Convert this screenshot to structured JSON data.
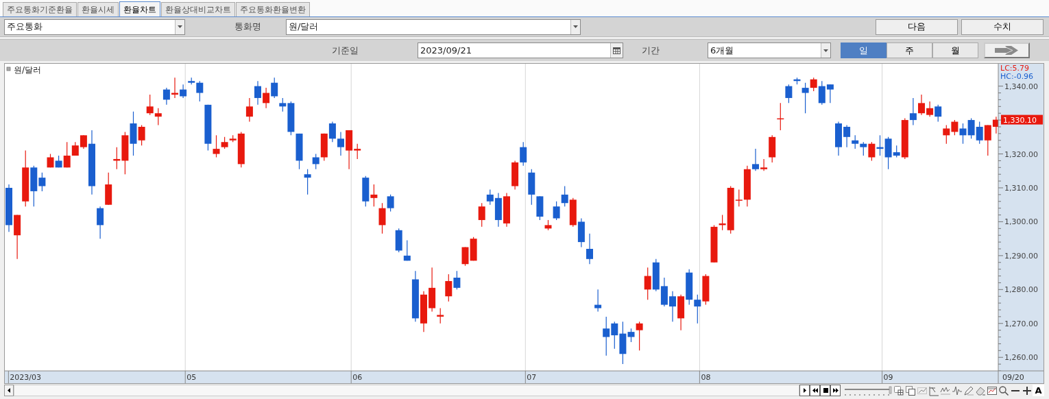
{
  "tabs": [
    {
      "label": "주요통화기준환율",
      "selected": false
    },
    {
      "label": "환율시세",
      "selected": false
    },
    {
      "label": "환율차트",
      "selected": true
    },
    {
      "label": "환율상대비교차트",
      "selected": false
    },
    {
      "label": "주요통화환율변환",
      "selected": false
    }
  ],
  "filter": {
    "group": "주요통화",
    "currency_label": "통화명",
    "currency": "원/달러",
    "buttons": [
      "다음",
      "수치"
    ]
  },
  "query": {
    "date_label": "기준일",
    "date": "2023/09/21",
    "period_label": "기간",
    "period": "6개월",
    "intervals": [
      {
        "label": "일",
        "selected": true
      },
      {
        "label": "주",
        "selected": false
      },
      {
        "label": "월",
        "selected": false
      }
    ]
  },
  "chart": {
    "lc_label": "LC:5.79",
    "hc_label": "HC:-0.96",
    "last_price_label": "1,330.10",
    "x_end_label": "09/20",
    "chart_data": {
      "type": "candlestick",
      "title": "원/달러",
      "ylim": [
        1256,
        1346.6
      ],
      "yticks": [
        {
          "value": 1260,
          "label": "1,260.00"
        },
        {
          "value": 1270,
          "label": "1,270.00"
        },
        {
          "value": 1280,
          "label": "1,280.00"
        },
        {
          "value": 1290,
          "label": "1,290.00"
        },
        {
          "value": 1300,
          "label": "1,300.00"
        },
        {
          "value": 1310,
          "label": "1,310.00"
        },
        {
          "value": 1320,
          "label": "1,320.00"
        },
        {
          "value": 1340,
          "label": "1,340.00"
        }
      ],
      "categories": [
        null,
        null,
        "2023/03",
        null,
        null,
        null,
        null,
        null,
        null,
        null,
        null,
        null,
        null,
        null,
        null,
        null,
        null,
        null,
        null,
        null,
        null,
        null,
        "05",
        null,
        null,
        null,
        null,
        null,
        null,
        null,
        null,
        null,
        null,
        null,
        null,
        null,
        null,
        null,
        null,
        null,
        null,
        null,
        "06",
        null,
        null,
        null,
        null,
        null,
        null,
        null,
        null,
        null,
        null,
        null,
        null,
        null,
        null,
        null,
        null,
        null,
        null,
        null,
        null,
        "07",
        null,
        null,
        null,
        null,
        null,
        null,
        null,
        null,
        null,
        null,
        null,
        null,
        null,
        null,
        null,
        null,
        null,
        null,
        null,
        null,
        "08",
        null,
        null,
        null,
        null,
        null,
        null,
        null,
        null,
        null,
        null,
        null,
        null,
        null,
        null,
        null,
        null,
        null,
        null,
        null,
        null,
        null,
        "09",
        null,
        null,
        null,
        null,
        null,
        null,
        null,
        null,
        null,
        null,
        null,
        null,
        null
      ],
      "ohlc": [
        [
          1310,
          1311,
          1297,
          1299
        ],
        [
          1296,
          1302,
          1289,
          1302
        ],
        [
          1306,
          1321,
          1304.5,
          1316
        ],
        [
          1316,
          1316.5,
          1304.5,
          1309
        ],
        [
          1313,
          1314.5,
          1309,
          1310.5
        ],
        [
          1316,
          1320,
          1316,
          1319
        ],
        [
          1318,
          1319.5,
          1316,
          1316
        ],
        [
          1316,
          1323.5,
          1316,
          1319.5
        ],
        [
          1319.5,
          1323.5,
          1319.5,
          1322.5
        ],
        [
          1322,
          1325.5,
          1321.5,
          1325.5
        ],
        [
          1323,
          1327,
          1308,
          1310.5
        ],
        [
          1304,
          1304.5,
          1295,
          1299
        ],
        [
          1305,
          1314.5,
          1305,
          1311
        ],
        [
          1318,
          1322,
          1315.5,
          1318.5
        ],
        [
          1318,
          1326.5,
          1314,
          1325.5
        ],
        [
          1329,
          1332.5,
          1319.5,
          1323
        ],
        [
          1324,
          1328.5,
          1322.5,
          1328
        ],
        [
          1332,
          1337.5,
          1331.5,
          1334
        ],
        [
          1331,
          1333.5,
          1328.5,
          1332
        ],
        [
          1339,
          1339.5,
          1334.5,
          1336
        ],
        [
          1337.5,
          1342.5,
          1336.5,
          1338
        ],
        [
          1339,
          1340.5,
          1336.5,
          1337
        ],
        [
          1341.5,
          1342.5,
          1340.5,
          1341
        ],
        [
          1341,
          1341.5,
          1335.5,
          1338
        ],
        [
          1334.5,
          1334.5,
          1321,
          1323
        ],
        [
          1320,
          1325.5,
          1319,
          1321.5
        ],
        [
          1322,
          1325,
          1321.5,
          1323.5
        ],
        [
          1324,
          1325.5,
          1323.5,
          1324.5
        ],
        [
          1317,
          1326.5,
          1316,
          1326
        ],
        [
          1331,
          1336.5,
          1329.5,
          1334
        ],
        [
          1340,
          1341.5,
          1334.5,
          1336.5
        ],
        [
          1335,
          1339.5,
          1333.5,
          1338
        ],
        [
          1341,
          1342.5,
          1336.5,
          1337
        ],
        [
          1335,
          1336.5,
          1332.5,
          1334
        ],
        [
          1335,
          1335.5,
          1325.5,
          1326.5
        ],
        [
          1326,
          1326,
          1315.5,
          1318
        ],
        [
          1314,
          1315.5,
          1308,
          1313
        ],
        [
          1319,
          1320,
          1315.5,
          1317
        ],
        [
          1319,
          1326,
          1318,
          1326
        ],
        [
          1329,
          1329.5,
          1323.5,
          1324.5
        ],
        [
          1324.5,
          1326.5,
          1319.5,
          1322
        ],
        [
          1321,
          1327,
          1315.5,
          1327
        ],
        [
          1321,
          1323,
          1318.5,
          1321.5
        ],
        [
          1313,
          1313.5,
          1304.5,
          1306
        ],
        [
          1307,
          1311,
          1304.5,
          1308
        ],
        [
          1299,
          1305.5,
          1296.5,
          1304
        ],
        [
          1307.5,
          1308,
          1303,
          1304
        ],
        [
          1297.5,
          1298,
          1291,
          1291.5
        ],
        [
          1290,
          1294.5,
          1288.5,
          1288.5
        ],
        [
          1283,
          1285.5,
          1270.5,
          1271.5
        ],
        [
          1270,
          1279.5,
          1267.5,
          1278.5
        ],
        [
          1274.5,
          1286.5,
          1273.5,
          1280.5
        ],
        [
          1272,
          1274.5,
          1270,
          1272.5
        ],
        [
          1278,
          1284.5,
          1276.5,
          1282.5
        ],
        [
          1283.5,
          1285.5,
          1280,
          1280.5
        ],
        [
          1287.5,
          1292.5,
          1287,
          1292.5
        ],
        [
          1288.5,
          1295.5,
          1288.5,
          1295
        ],
        [
          1300.5,
          1305.5,
          1298.5,
          1304.5
        ],
        [
          1308,
          1309.5,
          1305,
          1306
        ],
        [
          1307,
          1308.5,
          1298.5,
          1300.5
        ],
        [
          1299.5,
          1308.5,
          1298.5,
          1307.5
        ],
        [
          1310.5,
          1318,
          1309.5,
          1317.5
        ],
        [
          1322,
          1323.5,
          1316.5,
          1317.5
        ],
        [
          1314.5,
          1315.5,
          1305,
          1308
        ],
        [
          1307.5,
          1307.5,
          1300.5,
          1301.5
        ],
        [
          1298,
          1300.5,
          1297.5,
          1299
        ],
        [
          1304.5,
          1306,
          1300.5,
          1301
        ],
        [
          1308,
          1310.5,
          1304.5,
          1305.5
        ],
        [
          1299,
          1307,
          1298.5,
          1306.5
        ],
        [
          1300,
          1301,
          1292.5,
          1294
        ],
        [
          1292,
          1296.5,
          1287.5,
          1289
        ],
        [
          1275.5,
          1280,
          1273.5,
          1274.5
        ],
        [
          1268.5,
          1272,
          1260.5,
          1266
        ],
        [
          1270,
          1270.5,
          1262.5,
          1266.5
        ],
        [
          1267,
          1270.5,
          1258,
          1261
        ],
        [
          1267.5,
          1268.5,
          1264.5,
          1266
        ],
        [
          1268,
          1270.5,
          1262,
          1270
        ],
        [
          1280,
          1286.5,
          1277,
          1284
        ],
        [
          1288,
          1289,
          1279.5,
          1280
        ],
        [
          1281,
          1283.5,
          1275,
          1275.5
        ],
        [
          1278,
          1279.5,
          1270.5,
          1275
        ],
        [
          1271.5,
          1278.5,
          1268,
          1278
        ],
        [
          1285,
          1286,
          1275.5,
          1277
        ],
        [
          1277,
          1278.5,
          1270,
          1275
        ],
        [
          1276.5,
          1284.5,
          1275.5,
          1284
        ],
        [
          1288,
          1299,
          1288,
          1298.5
        ],
        [
          1299,
          1302,
          1297.5,
          1299.5
        ],
        [
          1297.5,
          1310.5,
          1296.5,
          1310
        ],
        [
          1306.3,
          1309.5,
          1304.5,
          1306.5
        ],
        [
          1306.5,
          1316.5,
          1304.5,
          1315.5
        ],
        [
          1317,
          1321.5,
          1315,
          1315.5
        ],
        [
          1315.5,
          1318.5,
          1315,
          1316
        ],
        [
          1319,
          1325.5,
          1317.5,
          1325
        ],
        [
          1330.3,
          1335,
          1327,
          1330.5
        ],
        [
          1340,
          1340.5,
          1335,
          1336.5
        ],
        [
          1342,
          1342.5,
          1340.5,
          1341.5
        ],
        [
          1339.5,
          1341,
          1332,
          1338
        ],
        [
          1339.5,
          1342.5,
          1338.5,
          1342
        ],
        [
          1340,
          1341.5,
          1334.5,
          1335
        ],
        [
          1340.5,
          1340.5,
          1335,
          1339
        ],
        [
          1329,
          1329.5,
          1319.5,
          1322
        ],
        [
          1328,
          1328.5,
          1322,
          1325
        ],
        [
          1324,
          1325.5,
          1321.5,
          1323
        ],
        [
          1323,
          1323.5,
          1319.5,
          1322
        ],
        [
          1319,
          1323.5,
          1318,
          1323
        ],
        [
          1322,
          1325.5,
          1319.5,
          1321.5
        ],
        [
          1324.5,
          1325,
          1315.5,
          1319
        ],
        [
          1320.5,
          1322.5,
          1319,
          1319.5
        ],
        [
          1319,
          1330.5,
          1318.5,
          1330
        ],
        [
          1332,
          1336.5,
          1328.5,
          1330
        ],
        [
          1332,
          1337.5,
          1331.5,
          1335
        ],
        [
          1331.5,
          1335.5,
          1331,
          1333.5
        ],
        [
          1334,
          1334.5,
          1329.5,
          1331
        ],
        [
          1325.5,
          1328.5,
          1323,
          1327.5
        ],
        [
          1326.5,
          1330,
          1325.5,
          1329.5
        ],
        [
          1327.5,
          1329,
          1323,
          1325.5
        ],
        [
          1330,
          1330.5,
          1324.5,
          1325.5
        ],
        [
          1328,
          1329.5,
          1323,
          1324
        ],
        [
          1324,
          1328.5,
          1319.5,
          1328.5
        ],
        [
          1328,
          1331,
          1326,
          1330.1
        ]
      ]
    }
  },
  "toolbar": {
    "zoom_slider": {
      "level": 1
    },
    "font_button": "A"
  }
}
